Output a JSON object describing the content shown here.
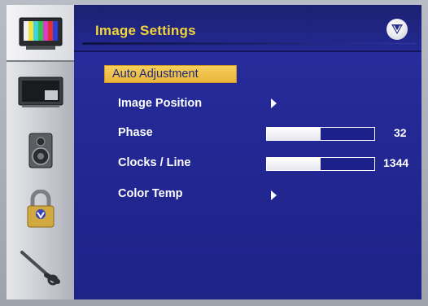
{
  "panel": {
    "title": "Image Settings",
    "logo": "v-logo-icon"
  },
  "sidebar": {
    "items": [
      {
        "name": "tv-color-bars-icon",
        "active": true
      },
      {
        "name": "monitor-pip-icon",
        "active": false
      },
      {
        "name": "speaker-icon",
        "active": false
      },
      {
        "name": "lock-icon",
        "active": false
      },
      {
        "name": "wrench-icon",
        "active": false
      }
    ]
  },
  "menu": {
    "items": [
      {
        "label": "Auto Adjustment",
        "type": "action",
        "selected": true
      },
      {
        "label": "Image Position",
        "type": "submenu"
      },
      {
        "label": "Phase",
        "type": "slider",
        "value": "32",
        "fill_fraction": 0.5
      },
      {
        "label": "Clocks / Line",
        "type": "slider",
        "value": "1344",
        "fill_fraction": 0.5
      },
      {
        "label": "Color Temp",
        "type": "submenu"
      }
    ]
  },
  "colors": {
    "panel_bg": "#232895",
    "title": "#f2d53a",
    "highlight": "#f0c24a",
    "text": "#ffffff",
    "selected_text": "#1f2a7a"
  }
}
